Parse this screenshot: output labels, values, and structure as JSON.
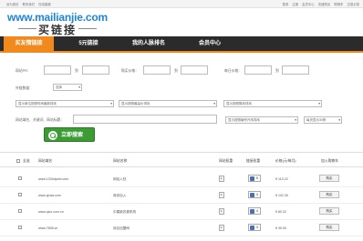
{
  "topbar": {
    "left": [
      "设为首页",
      "联系我们",
      "在线客服"
    ],
    "right": [
      "登录",
      "注册",
      "会员中心",
      "充值购买",
      "购物车",
      "交易记录"
    ]
  },
  "logo": {
    "url": "www.mailianjie.com",
    "name": "买链接"
  },
  "nav": {
    "tabs": [
      {
        "label": "买友情链接",
        "active": true
      },
      {
        "label": "5元链接",
        "active": false
      },
      {
        "label": "我的人脉排名",
        "active": false
      },
      {
        "label": "会员中心",
        "active": false
      }
    ]
  },
  "filters": {
    "row1": {
      "pr_label": "网站PR：",
      "to1": "到",
      "price_label": "购买价格：",
      "to2": "到",
      "count_label": "每日价格：",
      "to3": "到"
    },
    "row2": {
      "label": "外链数量：",
      "select_value": "选择"
    },
    "row3": {
      "select1": "显示单位按照时间最新排序",
      "select2": "显示按照最高价排序",
      "select3": "显示按照降序排序"
    },
    "row4": {
      "label": "网站域名、关键词、网站标题：",
      "select1": "显示按照编号升序排序",
      "select2": "每页显示30条"
    },
    "search_button": "立即搜索"
  },
  "table": {
    "headers": [
      "全选",
      "网站域名",
      "网站名称",
      "网站权重",
      "链接权重",
      "价格(元/每月)",
      "加入购物车"
    ],
    "rows": [
      {
        "domain": "www.1334dpeel.com",
        "name": "网站入驻",
        "weight": "1",
        "auth": "5",
        "price": "¥ 110.22",
        "buy": "购买"
      },
      {
        "domain": "www.vjxaa.com",
        "name": "商务加入",
        "weight": "1",
        "auth": "4",
        "price": "¥ 102.30",
        "buy": "购买"
      },
      {
        "domain": "www.ujxo.com.cn",
        "name": "中建新农委机构",
        "weight": "1",
        "auth": "4",
        "price": "¥ 80.22",
        "buy": "购买"
      },
      {
        "domain": "www.7808.cn",
        "name": "综合加盟网",
        "weight": "1",
        "auth": "3",
        "price": "¥ 35.00",
        "buy": "购买"
      }
    ]
  }
}
